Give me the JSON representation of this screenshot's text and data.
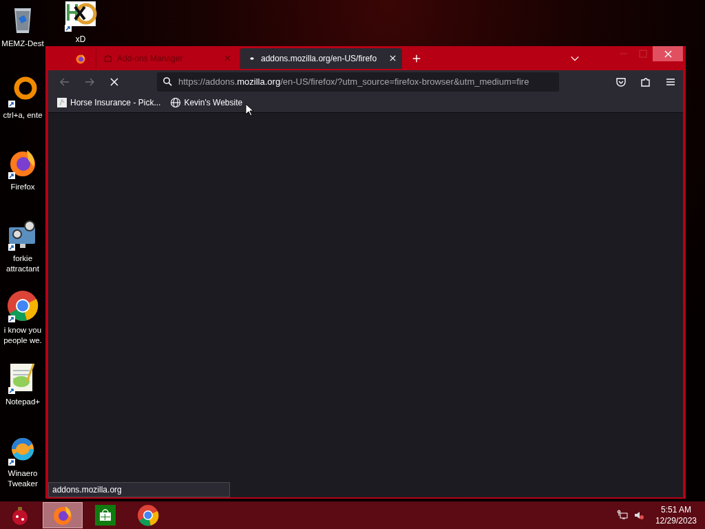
{
  "desktop_icons": [
    {
      "kind": "recycle-bin",
      "label": "MEMZ-Dest",
      "shortcut": false
    },
    {
      "kind": "hxd",
      "label": "xD",
      "shortcut": true
    },
    {
      "kind": "ring",
      "label": "ctrl+a, ente",
      "shortcut": true
    },
    {
      "kind": "firefox",
      "label": "Firefox",
      "shortcut": true
    },
    {
      "kind": "gears",
      "label": "forkie attractant",
      "shortcut": true
    },
    {
      "kind": "chrome",
      "label": "i know you people we.",
      "shortcut": true
    },
    {
      "kind": "notepad",
      "label": "Notepad+",
      "shortcut": true
    },
    {
      "kind": "winaero",
      "label": "Winaero Tweaker",
      "shortcut": true
    }
  ],
  "browser": {
    "tabs": [
      {
        "title": "Add-ons Manager",
        "selected": false,
        "kind": "addons"
      },
      {
        "title": "addons.mozilla.org/en-US/firefo",
        "selected": true,
        "kind": "page"
      }
    ],
    "nav": [
      {
        "kind": "back",
        "disabled": true
      },
      {
        "kind": "forward",
        "disabled": true
      },
      {
        "kind": "stop",
        "disabled": false
      }
    ],
    "address": {
      "prefix": "https://addons.",
      "host": "mozilla.org",
      "suffix": "/en-US/firefox/?utm_source=firefox-browser&utm_medium=fire"
    },
    "bookmarks": [
      {
        "kind": "page",
        "label": "Horse Insurance - Pick..."
      },
      {
        "kind": "globe",
        "label": "Kevin's Website"
      }
    ],
    "status_text": "addons.mozilla.org"
  },
  "taskbar": {
    "apps": [
      {
        "kind": "ornament",
        "selected": false
      },
      {
        "kind": "firefox",
        "selected": true
      },
      {
        "kind": "store",
        "selected": false
      },
      {
        "kind": "chrome",
        "selected": false
      }
    ],
    "time": "5:51 AM",
    "date": "12/29/2023"
  }
}
